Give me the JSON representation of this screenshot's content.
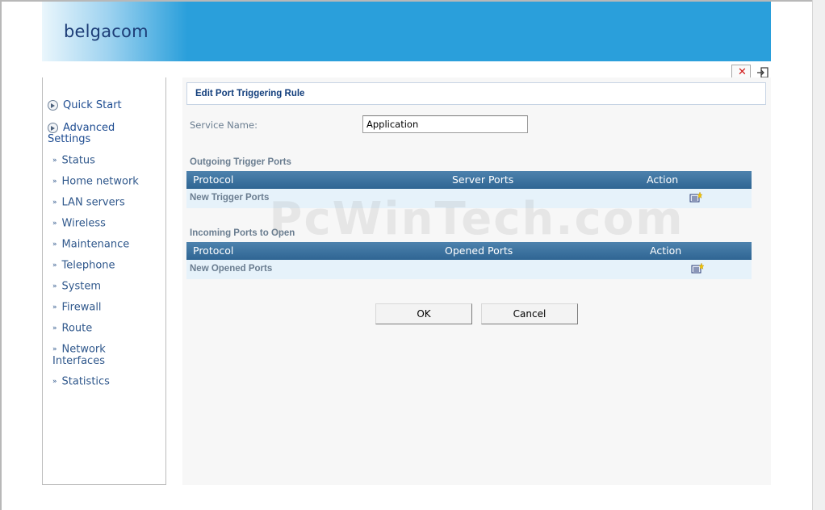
{
  "header": {
    "logo_text": "belgacom"
  },
  "sidebar": {
    "main_items": [
      {
        "label": "Quick Start"
      },
      {
        "label": "Advanced Settings"
      }
    ],
    "items": [
      {
        "label": "Status"
      },
      {
        "label": "Home network"
      },
      {
        "label": "LAN servers"
      },
      {
        "label": "Wireless"
      },
      {
        "label": "Maintenance"
      },
      {
        "label": "Telephone"
      },
      {
        "label": "System"
      },
      {
        "label": "Firewall"
      },
      {
        "label": "Route"
      },
      {
        "label": "Network Interfaces"
      },
      {
        "label": "Statistics"
      }
    ]
  },
  "page": {
    "title": "Edit Port Triggering Rule",
    "service_name_label": "Service Name:",
    "service_name_value": "Application",
    "outgoing": {
      "section_label": "Outgoing Trigger Ports",
      "columns": [
        "Protocol",
        "Server Ports",
        "Action"
      ],
      "new_label": "New Trigger Ports"
    },
    "incoming": {
      "section_label": "Incoming Ports to Open",
      "columns": [
        "Protocol",
        "Opened Ports",
        "Action"
      ],
      "new_label": "New Opened Ports"
    },
    "ok_label": "OK",
    "cancel_label": "Cancel",
    "watermark": "PcWinTech.com"
  },
  "icons": {
    "close": "close-icon",
    "logout": "logout-icon",
    "menu_bullet": "circle-arrow-icon",
    "add": "add-rule-icon"
  },
  "colors": {
    "header_blue": "#2a9fdb",
    "table_header": "#3a6f9b",
    "row_bg": "#e6f2fa",
    "link_blue": "#30588c"
  }
}
